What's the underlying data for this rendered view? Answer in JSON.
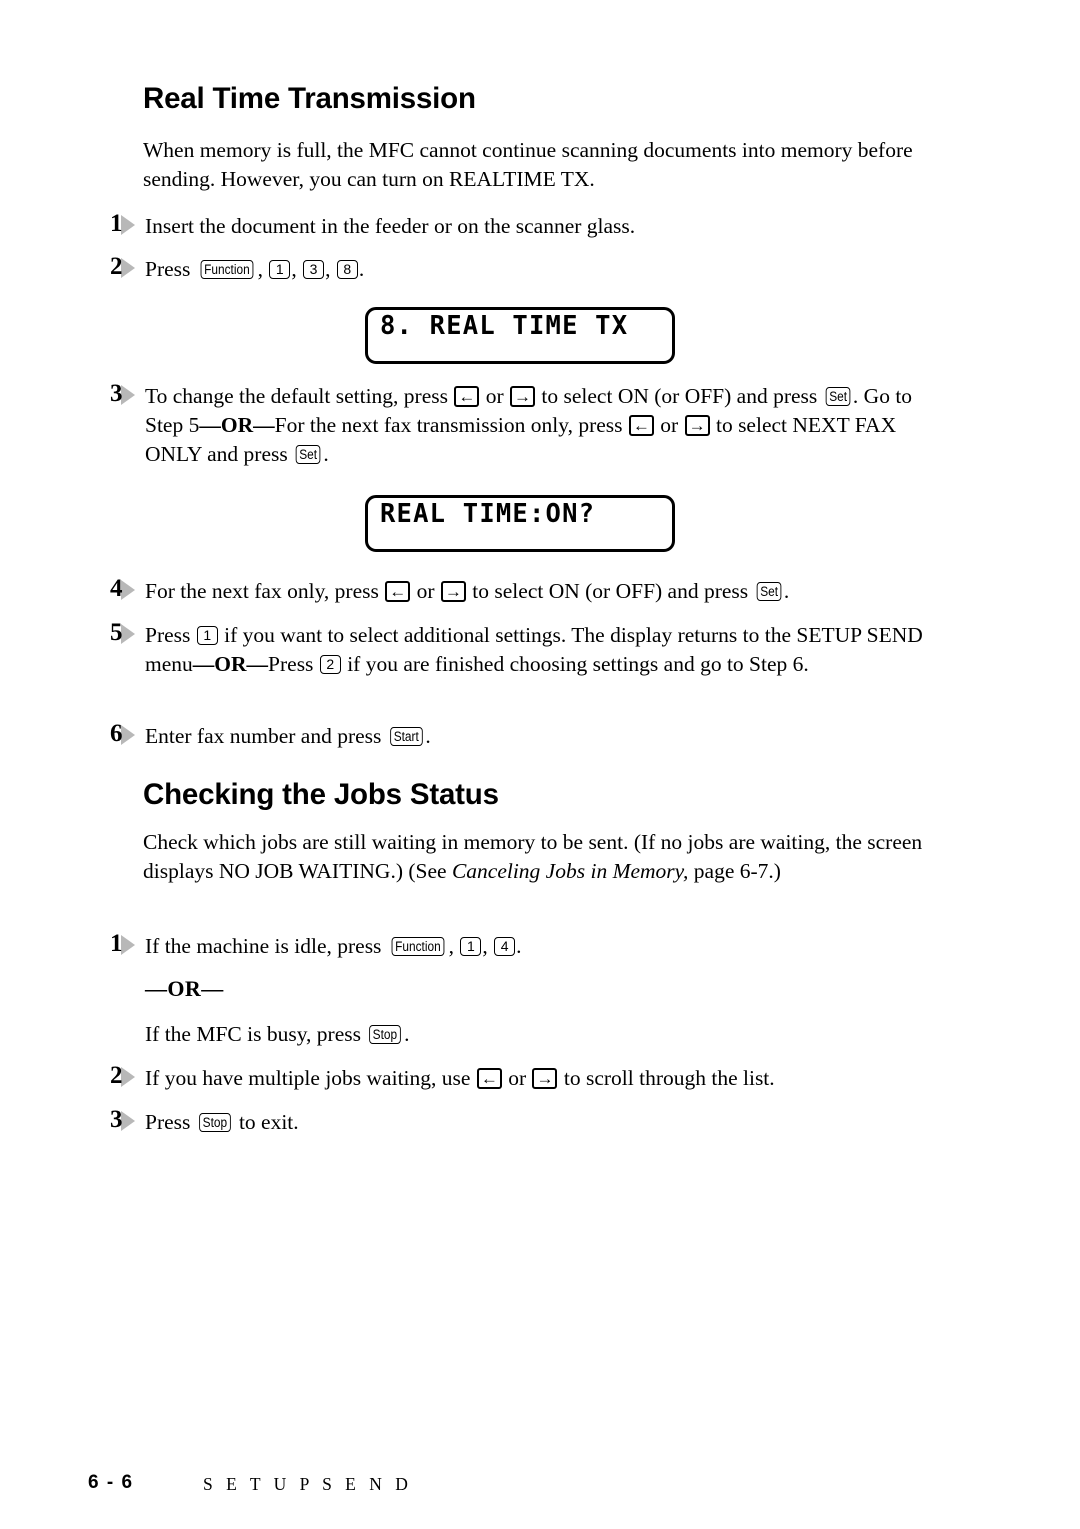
{
  "document": {
    "sections": [
      {
        "heading": "Real Time Transmission",
        "intro": "When memory is full, the MFC cannot continue scanning documents into memory before sending. However, you can turn on REALTIME TX."
      },
      {
        "heading": "Checking the Jobs Status",
        "intro_part1": "Check which jobs are still waiting in memory to be sent. (If no jobs are waiting, the screen displays NO JOB WAITING.) (See ",
        "intro_italic": "Canceling Jobs in Memory,",
        "intro_part2": " page 6-7.)"
      }
    ],
    "steps_rtt": {
      "s1": {
        "num": "1",
        "text": "Insert the document in the feeder or on the scanner glass."
      },
      "s2": {
        "num": "2",
        "press_label": "Press ",
        "key_function": "Function",
        "sep1": ", ",
        "key_1": "1",
        "sep2": ", ",
        "key_3": "3",
        "sep3": ", ",
        "key_8": "8",
        "end": "."
      },
      "s3": {
        "num": "3",
        "t1": "To change the default setting, press ",
        "arrow_left": "←",
        "t2": " or ",
        "arrow_right": "→",
        "t3": " to select ON (or OFF) and press ",
        "key_set": "Set",
        "t4": ".  Go to Step 5",
        "or": "—OR—",
        "t5": "For the next fax transmission only, press ",
        "t6": " or ",
        "t7": " to select NEXT FAX ONLY and press ",
        "t8": "."
      },
      "s4": {
        "num": "4",
        "t1": "For the next fax only, press ",
        "t2": " or ",
        "t3": " to select ON (or OFF) and press ",
        "key_set": "Set",
        "t4": "."
      },
      "s5": {
        "num": "5",
        "t1": "Press ",
        "key_1": "1",
        "t2": " if you want to select additional settings. The display returns to the SETUP SEND menu",
        "or": "—OR—",
        "t3": "Press ",
        "key_2": "2",
        "t4": " if you are finished choosing settings and go to Step 6."
      },
      "s6": {
        "num": "6",
        "t1": "Enter fax number and press ",
        "key_start": "Start",
        "t2": "."
      }
    },
    "steps_jobs": {
      "s1": {
        "num": "1",
        "t1": "If the machine is idle, press ",
        "key_function": "Function",
        "sep1": ", ",
        "key_1": "1",
        "sep2": ", ",
        "key_4": "4",
        "t2": "."
      },
      "or_divider": "—OR—",
      "busy_line": {
        "t1": "If the MFC is busy, press ",
        "key_stop": "Stop",
        "t2": "."
      },
      "s2": {
        "num": "2",
        "t1": "If you have multiple jobs waiting, use ",
        "arrow_left": "←",
        "t2": " or ",
        "arrow_right": "→",
        "t3": " to scroll through the list."
      },
      "s3": {
        "num": "3",
        "t1": "Press ",
        "key_stop": "Stop",
        "t2": " to exit."
      }
    },
    "lcd_displays": [
      {
        "text": "8. REAL TIME TX"
      },
      {
        "text": "REAL TIME:ON?"
      }
    ],
    "footer": {
      "page_number": "6 - 6",
      "section_title": "S E T U P   S E N D"
    }
  }
}
